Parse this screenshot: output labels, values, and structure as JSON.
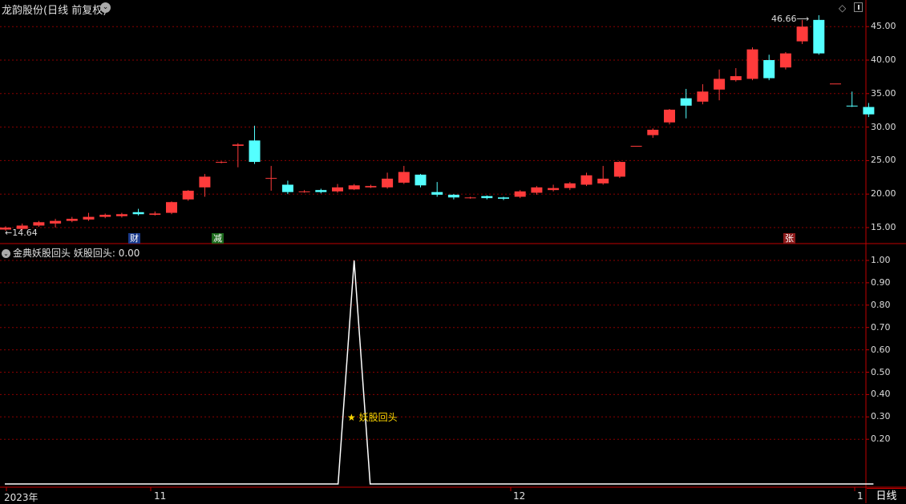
{
  "header": {
    "title": "龙韵股份(日线 前复权)",
    "indicator_title": "金典妖股回头",
    "indicator_value_label": "妖股回头: 0.00"
  },
  "price_axis": {
    "ticks": [
      "45.00",
      "40.00",
      "35.00",
      "30.00",
      "25.00",
      "20.00",
      "15.00"
    ],
    "values": [
      45,
      40,
      35,
      30,
      25,
      20,
      15
    ]
  },
  "ind_axis": {
    "ticks": [
      "1.00",
      "0.90",
      "0.80",
      "0.70",
      "0.60",
      "0.50",
      "0.40",
      "0.30",
      "0.20"
    ],
    "values": [
      1,
      0.9,
      0.8,
      0.7,
      0.6,
      0.5,
      0.4,
      0.3,
      0.2
    ]
  },
  "annotations": {
    "high": "46.66",
    "low": "14.64",
    "signal": "妖股回头"
  },
  "tags": {
    "cai": "财",
    "jian": "减",
    "zhang": "张"
  },
  "date_axis": {
    "labels": [
      "2023年",
      "11",
      "12",
      "1"
    ]
  },
  "period_label": "日线",
  "colors": {
    "up": "#ff3b3b",
    "down": "#54ffff",
    "grid": "#8b0000",
    "border": "#c00000",
    "signal": "#ffd800"
  },
  "chart_data": {
    "type": "candlestick",
    "ylim": [
      13,
      48
    ],
    "candles": [
      [
        14.7,
        15.0,
        14.5,
        15.2
      ],
      [
        14.8,
        15.3,
        14.6,
        15.6
      ],
      [
        15.3,
        15.8,
        15.1,
        16.0
      ],
      [
        15.6,
        16.0,
        15.0,
        16.3
      ],
      [
        16.0,
        16.3,
        15.8,
        16.6
      ],
      [
        16.2,
        16.6,
        16.0,
        17.2
      ],
      [
        16.6,
        16.9,
        16.4,
        17.1
      ],
      [
        16.7,
        17.0,
        16.5,
        17.2
      ],
      [
        17.3,
        17.0,
        16.8,
        17.8
      ],
      [
        16.9,
        17.1,
        16.8,
        17.4
      ],
      [
        17.2,
        18.8,
        17.0,
        18.9
      ],
      [
        19.2,
        20.5,
        19.0,
        20.6
      ],
      [
        21.0,
        22.6,
        19.6,
        23.0
      ],
      [
        24.7,
        24.8,
        24.6,
        24.9
      ],
      [
        27.2,
        27.4,
        24.0,
        27.6
      ],
      [
        28.0,
        24.8,
        24.5,
        30.2
      ],
      [
        22.3,
        22.4,
        20.5,
        24.2
      ],
      [
        21.4,
        20.3,
        20.0,
        22.0
      ],
      [
        20.3,
        20.4,
        20.2,
        20.6
      ],
      [
        20.6,
        20.3,
        20.1,
        20.8
      ],
      [
        20.4,
        21.0,
        20.2,
        21.5
      ],
      [
        20.7,
        21.3,
        20.6,
        21.5
      ],
      [
        21.0,
        21.2,
        20.9,
        21.4
      ],
      [
        21.0,
        22.3,
        20.8,
        23.2
      ],
      [
        21.7,
        23.3,
        21.5,
        24.2
      ],
      [
        22.9,
        21.3,
        21.0,
        23.0
      ],
      [
        20.3,
        19.9,
        19.6,
        21.8
      ],
      [
        19.9,
        19.5,
        19.2,
        20.0
      ],
      [
        19.5,
        19.5,
        19.3,
        19.6
      ],
      [
        19.7,
        19.4,
        19.2,
        19.8
      ],
      [
        19.5,
        19.3,
        19.1,
        19.6
      ],
      [
        19.6,
        20.4,
        19.4,
        20.6
      ],
      [
        20.2,
        21.0,
        19.9,
        21.2
      ],
      [
        20.6,
        20.9,
        20.4,
        21.4
      ],
      [
        20.9,
        21.6,
        20.6,
        21.8
      ],
      [
        21.4,
        22.8,
        21.2,
        23.2
      ],
      [
        21.6,
        22.3,
        21.4,
        24.2
      ],
      [
        22.6,
        24.8,
        22.4,
        24.9
      ],
      [
        27.2,
        27.2,
        27.2,
        27.2
      ],
      [
        28.8,
        29.6,
        28.4,
        29.8
      ],
      [
        30.7,
        32.6,
        30.4,
        32.7
      ],
      [
        34.3,
        33.2,
        31.3,
        35.7
      ],
      [
        33.8,
        35.3,
        33.4,
        36.4
      ],
      [
        35.6,
        37.2,
        34.0,
        38.6
      ],
      [
        37.0,
        37.6,
        36.8,
        38.8
      ],
      [
        37.2,
        41.6,
        37.0,
        41.9
      ],
      [
        40.0,
        37.3,
        37.0,
        40.8
      ],
      [
        38.9,
        41.0,
        38.6,
        41.2
      ],
      [
        42.8,
        45.0,
        42.4,
        46.0
      ],
      [
        46.0,
        41.0,
        40.8,
        46.7
      ],
      [
        36.5,
        36.5,
        36.5,
        36.5
      ],
      [
        33.2,
        33.1,
        33.0,
        35.3
      ],
      [
        33.0,
        31.9,
        31.5,
        33.6
      ]
    ],
    "indicator": {
      "signal_index": 21,
      "peak_value": 1.0,
      "baseline_value": 0.0
    }
  }
}
